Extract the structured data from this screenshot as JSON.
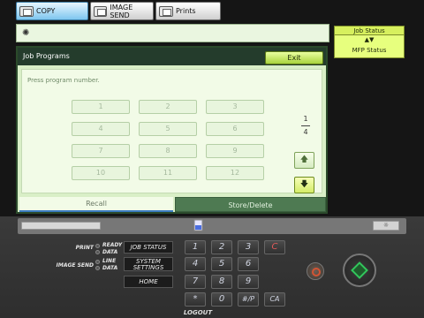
{
  "tabs": [
    {
      "label": "COPY",
      "active": true
    },
    {
      "label": "IMAGE SEND",
      "active": false
    },
    {
      "label": "Prints",
      "active": false
    }
  ],
  "job_status": {
    "header": "Job Status",
    "label": "MFP Status"
  },
  "panel": {
    "title": "Job Programs",
    "exit_label": "Exit",
    "prompt": "Press program number.",
    "buttons": [
      "1",
      "2",
      "3",
      "4",
      "5",
      "6",
      "7",
      "8",
      "9",
      "10",
      "11",
      "12"
    ],
    "page_current": "1",
    "page_total": "4",
    "tab_recall": "Recall",
    "tab_store": "Store/Delete"
  },
  "control_panel": {
    "print_label": "PRINT",
    "ready_label": "READY",
    "data_label": "DATA",
    "image_send_label": "IMAGE SEND",
    "line_label": "LINE",
    "data2_label": "DATA",
    "job_status_button": "JOB STATUS",
    "system_settings_line1": "SYSTEM",
    "system_settings_line2": "SETTINGS",
    "home_button": "HOME",
    "keypad": [
      "1",
      "2",
      "3",
      "C",
      "4",
      "5",
      "6",
      "7",
      "8",
      "9",
      "*",
      "0",
      "#/P",
      "CA"
    ],
    "logout_label": "LOGOUT"
  },
  "colors": {
    "panel_title_bg": "#243c2c",
    "exit_bg": "#a8d33c",
    "job_status_bg": "#e7ff7e",
    "active_tab": "#7ec6ef"
  }
}
